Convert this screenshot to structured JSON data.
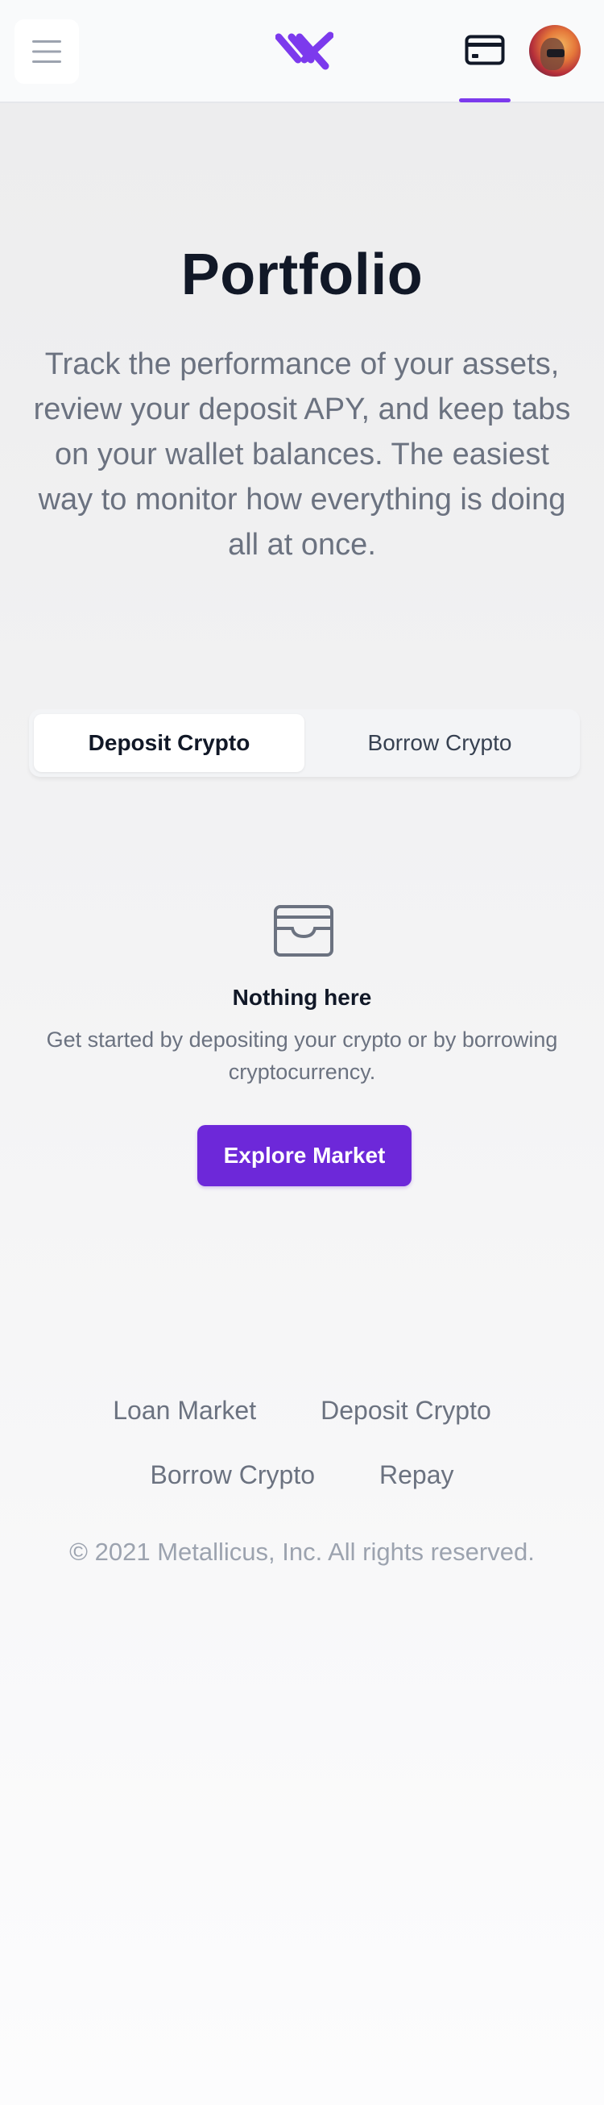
{
  "header": {
    "menu_icon": "hamburger-menu-icon",
    "logo_icon": "metallicus-logo-icon",
    "wallet_icon": "credit-card-icon",
    "avatar_icon": "user-avatar",
    "accent_color": "#7c3aed"
  },
  "hero": {
    "title": "Portfolio",
    "description": "Track the performance of your assets, review your deposit APY, and keep tabs on your wallet balances. The easiest way to monitor how everything is doing all at once."
  },
  "tabs": [
    {
      "label": "Deposit Crypto",
      "active": true
    },
    {
      "label": "Borrow Crypto",
      "active": false
    }
  ],
  "empty_state": {
    "icon": "inbox-tray-icon",
    "title": "Nothing here",
    "text": "Get started by depositing your crypto or by borrowing cryptocurrency.",
    "button_label": "Explore Market",
    "button_color": "#6d28d9"
  },
  "footer": {
    "links": [
      "Loan Market",
      "Deposit Crypto",
      "Borrow Crypto",
      "Repay"
    ],
    "copyright": "© 2021 Metallicus, Inc. All rights reserved."
  }
}
